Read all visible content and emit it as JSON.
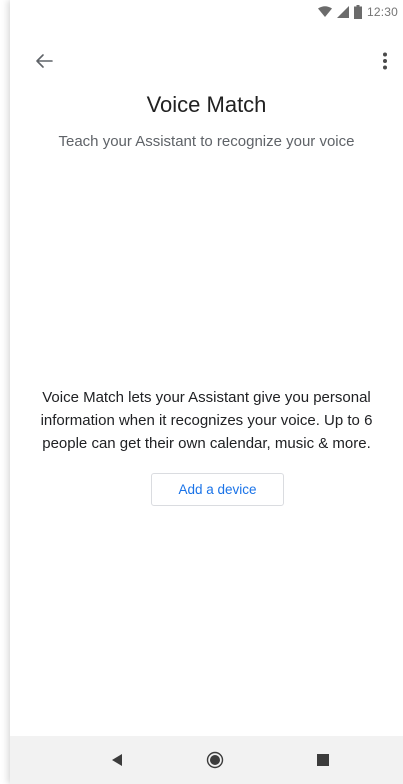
{
  "status_bar": {
    "time": "12:30",
    "icons": [
      "wifi-icon",
      "cellular-signal-icon",
      "battery-icon"
    ]
  },
  "toolbar": {
    "back_icon": "arrow-back-icon",
    "more_icon": "more-vertical-icon"
  },
  "page": {
    "title": "Voice Match",
    "subtitle": "Teach your Assistant to recognize your voice",
    "description": "Voice Match lets your Assistant give you personal information when it recognizes your voice. Up to 6 people can get their own calendar, music & more.",
    "add_device_label": "Add a device"
  },
  "nav_bar": {
    "icons": [
      "nav-back-icon",
      "nav-home-icon",
      "nav-recents-icon"
    ]
  },
  "colors": {
    "accent": "#1a73e8",
    "title_text": "#212121",
    "secondary_text": "#5f6368",
    "nav_bar_bg": "#f2f2f2"
  }
}
